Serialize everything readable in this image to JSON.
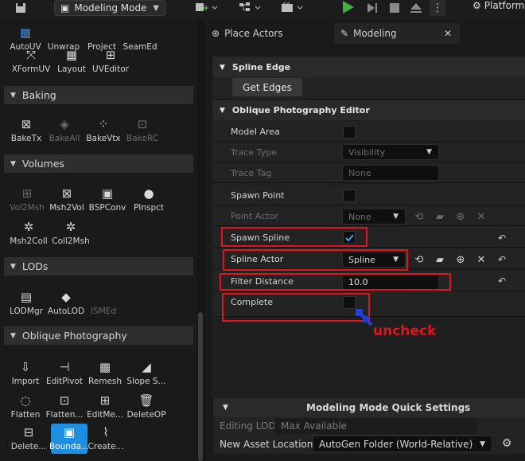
{
  "toolbar": {
    "mode_label": "Modeling Mode",
    "platform_label": "Platform",
    "icons": [
      "save-icon",
      "add-content-icon",
      "blueprint-icon",
      "cinematics-icon",
      "play-icon",
      "step-icon",
      "stop-icon",
      "eject-icon",
      "more-icon"
    ]
  },
  "left_panel": {
    "rows_top": [
      [
        {
          "label": "AutoUV",
          "icon": "autouv-icon"
        },
        {
          "label": "Unwrap",
          "icon": "unwrap-icon"
        },
        {
          "label": "Project",
          "icon": "project-icon"
        },
        {
          "label": "SeamEd",
          "icon": "seamed-icon"
        }
      ],
      [
        {
          "label": "XFormUV",
          "icon": "xformuv-icon"
        },
        {
          "label": "Layout",
          "icon": "layout-icon"
        },
        {
          "label": "UVEditor",
          "icon": "uveditor-icon"
        }
      ]
    ],
    "categories": {
      "baking": "Baking",
      "volumes": "Volumes",
      "lods": "LODs",
      "oblique": "Oblique Photography"
    },
    "baking_tools": [
      {
        "label": "BakeTx",
        "enabled": true
      },
      {
        "label": "BakeAll",
        "enabled": false
      },
      {
        "label": "BakeVtx",
        "enabled": true
      },
      {
        "label": "BakeRC",
        "enabled": false
      }
    ],
    "volume_tools_1": [
      {
        "label": "Vol2Msh",
        "enabled": false
      },
      {
        "label": "Msh2Vol",
        "enabled": true
      },
      {
        "label": "BSPConv",
        "enabled": true
      },
      {
        "label": "PInspct",
        "enabled": true
      }
    ],
    "volume_tools_2": [
      {
        "label": "Msh2Coll",
        "enabled": true
      },
      {
        "label": "Coll2Msh",
        "enabled": true
      }
    ],
    "lod_tools": [
      {
        "label": "LODMgr",
        "enabled": true
      },
      {
        "label": "AutoLOD",
        "enabled": true
      },
      {
        "label": "ISMEd",
        "enabled": false
      }
    ],
    "oblique_tools_1": [
      {
        "label": "Import"
      },
      {
        "label": "EditPivot"
      },
      {
        "label": "Remesh"
      },
      {
        "label": "Slope S..."
      }
    ],
    "oblique_tools_2": [
      {
        "label": "Flatten"
      },
      {
        "label": "Flatten..."
      },
      {
        "label": "EditMe..."
      },
      {
        "label": "DeleteOP"
      }
    ],
    "oblique_tools_3": [
      {
        "label": "Delete..."
      },
      {
        "label": "Bounda..."
      },
      {
        "label": "Create..."
      }
    ]
  },
  "tabs": {
    "place_actors": "Place Actors",
    "modeling": "Modeling",
    "close": "✕"
  },
  "details": {
    "spline_edge_header": "Spline Edge",
    "get_edges_button": "Get Edges",
    "oblique_header": "Oblique Photography Editor",
    "rows": {
      "model_area": "Model Area",
      "trace_type": "Trace Type",
      "trace_type_value": "Visibility",
      "trace_tag": "Trace Tag",
      "trace_tag_value": "None",
      "spawn_point": "Spawn Point",
      "point_actor": "Point Actor",
      "point_actor_value": "None",
      "spawn_spline": "Spawn Spline",
      "spline_actor": "Spline Actor",
      "spline_actor_value": "Spline",
      "filter_distance": "Filter Distance",
      "filter_distance_value": "10.0",
      "complete": "Complete"
    },
    "spawn_spline_checked": true,
    "complete_checked": false
  },
  "annotation": {
    "text": "uncheck",
    "color": "#e0141c"
  },
  "quick_settings": {
    "header": "Modeling Mode Quick Settings",
    "editing_lod_label": "Editing LOD",
    "editing_lod_value": "Max Available",
    "new_asset_label": "New Asset Location",
    "new_asset_value": "AutoGen Folder (World-Relative)"
  },
  "colors": {
    "accent": "#1e8ee0",
    "highlight": "#e0141c"
  }
}
